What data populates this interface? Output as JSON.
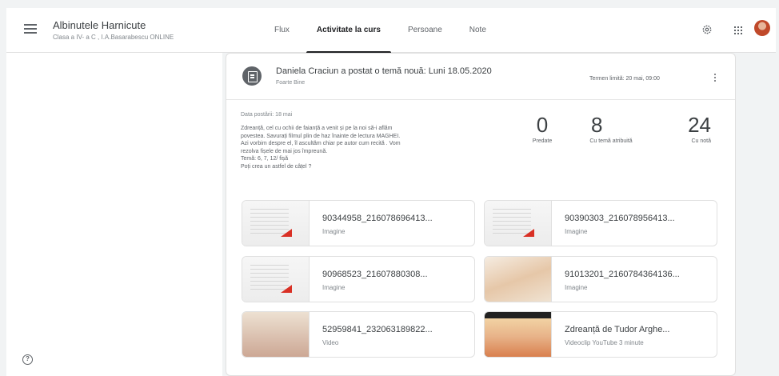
{
  "header": {
    "class_title": "Albinutele Harnicute",
    "class_subtitle": "Clasa a IV- a C , I.A.Basarabescu ONLINE",
    "tabs": [
      {
        "label": "Flux"
      },
      {
        "label": "Activitate la curs",
        "active": true
      },
      {
        "label": "Persoane"
      },
      {
        "label": "Note"
      }
    ],
    "icons": [
      "menu-icon",
      "settings-icon",
      "apps-grid-icon",
      "avatar"
    ]
  },
  "post": {
    "title": "Daniela Craciun a postat o temă nouă: Luni 18.05.2020",
    "grade": "Foarte Bine",
    "deadline": "Termen limită: 20 mai, 09:00",
    "posted_date": "Data postării: 18 mai",
    "text": "Zdreanță, cel cu ochii de faianță a venit și pe la noi să-i aflăm\npovestea. Savurați filmul plin de haz înainte de lectura MAGHEI.\nAzi vorbim despre el, îl ascultăm chiar pe autor cum recită . Vom\nrezolva fișele de mai jos împreună.\nTemă: 6, 7, 12/ fișă\nPoți crea un astfel de câțel ?",
    "stats": [
      {
        "value": "0",
        "label": "Predate"
      },
      {
        "value": "8",
        "label": "Cu temă atribuită"
      },
      {
        "value": "24",
        "label": "Cu notă"
      }
    ],
    "attachments": [
      {
        "name": "90344958_216078696413...",
        "type": "Imagine"
      },
      {
        "name": "90390303_216078956413...",
        "type": "Imagine"
      },
      {
        "name": "90968523_21607880308...",
        "type": "Imagine"
      },
      {
        "name": "91013201_2160784364136...",
        "type": "Imagine"
      },
      {
        "name": "52959841_232063189822...",
        "type": "Video"
      },
      {
        "name": "Zdreanță de Tudor Arghe...",
        "type": "Videoclip YouTube   3 minute"
      }
    ]
  },
  "footer": {
    "help_label": "?"
  }
}
